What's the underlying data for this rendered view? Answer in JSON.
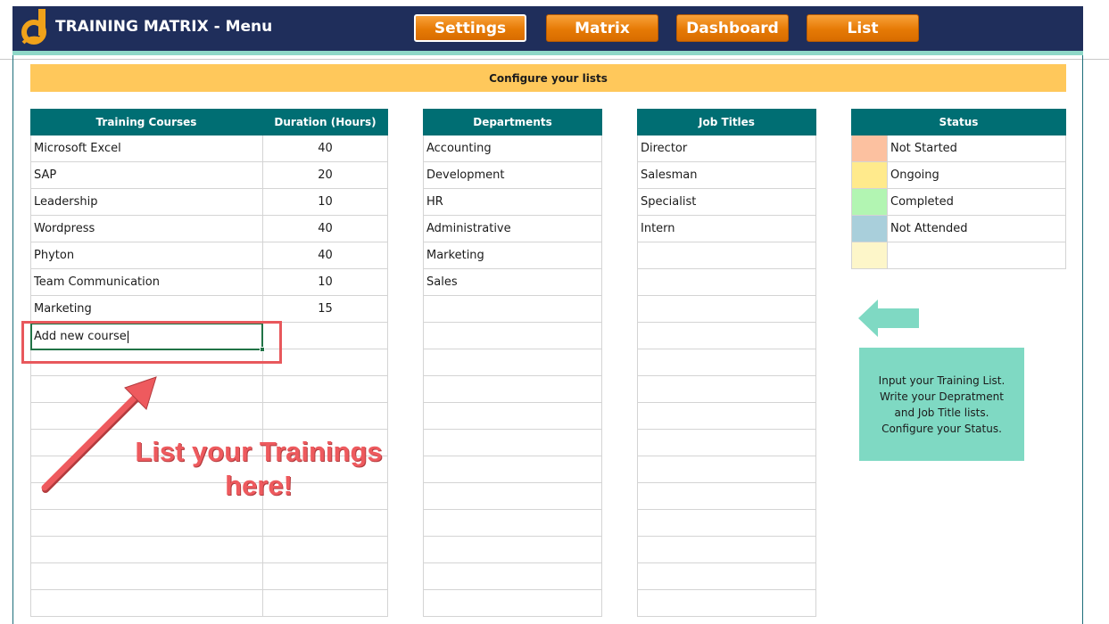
{
  "header": {
    "title": "TRAINING MATRIX - Menu",
    "nav": [
      "Settings",
      "Matrix",
      "Dashboard",
      "List"
    ]
  },
  "banner": "Configure your lists",
  "courses": {
    "headers": [
      "Training Courses",
      "Duration (Hours)"
    ],
    "rows": [
      [
        "Microsoft Excel",
        "40"
      ],
      [
        "SAP",
        "20"
      ],
      [
        "Leadership",
        "10"
      ],
      [
        "Wordpress",
        "40"
      ],
      [
        "Phyton",
        "40"
      ],
      [
        "Team Communication",
        "10"
      ],
      [
        "Marketing",
        "15"
      ]
    ],
    "input_value": "Add new course"
  },
  "departments": {
    "header": "Departments",
    "items": [
      "Accounting",
      "Development",
      "HR",
      "Administrative",
      "Marketing",
      "Sales"
    ]
  },
  "job_titles": {
    "header": "Job Titles",
    "items": [
      "Director",
      "Salesman",
      "Specialist",
      "Intern"
    ]
  },
  "status": {
    "header": "Status",
    "items": [
      {
        "label": "Not Started",
        "color": "#fcc1a0"
      },
      {
        "label": "Ongoing",
        "color": "#ffea8c"
      },
      {
        "label": "Completed",
        "color": "#b2f5b2"
      },
      {
        "label": "Not Attended",
        "color": "#a9cfdb"
      },
      {
        "label": "",
        "color": "#fdf6c9"
      }
    ]
  },
  "callout": {
    "line1": "List your Trainings",
    "line2": "here!"
  },
  "note": {
    "line1": "Input your Training List.",
    "line2": "Write your Depratment",
    "line3": "and Job Title lists.",
    "line4": "Configure your Status."
  },
  "colors": {
    "header_bg": "#1f2e5b",
    "table_header": "#006e73",
    "nav_button": "#f08c1a",
    "banner": "#ffc85b",
    "callout": "#ee5a5e",
    "note": "#7fd9c3"
  }
}
